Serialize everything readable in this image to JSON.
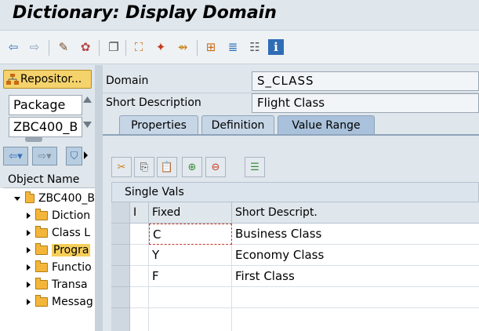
{
  "window": {
    "title": "Dictionary: Display Domain"
  },
  "toolbar": {
    "buttons": [
      {
        "name": "back-icon",
        "glyph": "⇦"
      },
      {
        "name": "forward-icon",
        "glyph": "⇨"
      },
      {
        "name": "display-change-icon",
        "glyph": "✎"
      },
      {
        "name": "activate-icon",
        "glyph": "✿"
      },
      {
        "name": "copy-object-icon",
        "glyph": "❐"
      },
      {
        "name": "where-used-icon",
        "glyph": "⛶"
      },
      {
        "name": "magic-wand-icon",
        "glyph": "✦"
      },
      {
        "name": "navigate-icon",
        "glyph": "⇴"
      },
      {
        "name": "hierarchy-icon",
        "glyph": "⊞"
      },
      {
        "name": "stack-icon",
        "glyph": "≣"
      },
      {
        "name": "list-icon",
        "glyph": "☷"
      },
      {
        "name": "info-icon",
        "glyph": "i"
      }
    ]
  },
  "nav": {
    "repository_button": "Repositor...",
    "package_combo": "Package",
    "package_value": "ZBC400_B",
    "object_name_header": "Object Name",
    "tree": [
      {
        "label": "ZBC400_B",
        "level": 0,
        "expanded": true
      },
      {
        "label": "Diction",
        "level": 1,
        "expanded": false
      },
      {
        "label": "Class L",
        "level": 1,
        "expanded": false
      },
      {
        "label": "Progra",
        "level": 1,
        "expanded": false,
        "selected": true
      },
      {
        "label": "Functio",
        "level": 1,
        "expanded": false
      },
      {
        "label": "Transa",
        "level": 1,
        "expanded": false
      },
      {
        "label": "Messag",
        "level": 1,
        "expanded": false
      }
    ]
  },
  "header_fields": {
    "domain_label": "Domain",
    "domain_value": "S_CLASS",
    "short_desc_label": "Short Description",
    "short_desc_value": "Flight Class"
  },
  "tabs": [
    {
      "label": "Properties",
      "active": false
    },
    {
      "label": "Definition",
      "active": false
    },
    {
      "label": "Value Range",
      "active": true
    }
  ],
  "table": {
    "caption": "Single Vals",
    "columns": [
      "I",
      "Fixed",
      "Short Descript."
    ],
    "rows": [
      {
        "fixed": "C",
        "desc": "Business Class"
      },
      {
        "fixed": "Y",
        "desc": "Economy Class"
      },
      {
        "fixed": "F",
        "desc": "First Class"
      }
    ]
  },
  "colors": {
    "accent_folder": "#f4b63a",
    "repo_button": "#f4d26c",
    "active_tab": "#a9c1da"
  }
}
